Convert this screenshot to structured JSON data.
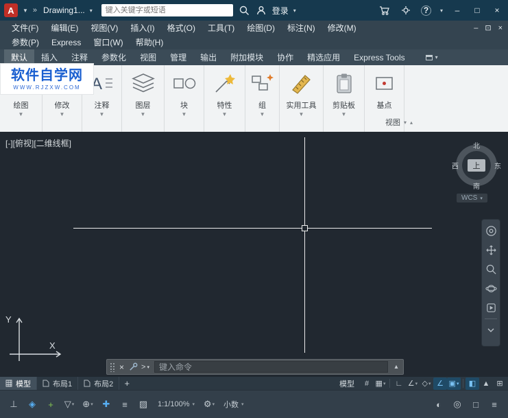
{
  "titlebar": {
    "doc_title": "Drawing1...",
    "search_placeholder": "键入关键字或短语",
    "signin": "登录",
    "help": "?"
  },
  "menubar": {
    "row1": [
      "文件(F)",
      "编辑(E)",
      "视图(V)",
      "插入(I)",
      "格式(O)",
      "工具(T)",
      "绘图(D)",
      "标注(N)",
      "修改(M)"
    ],
    "row2": [
      "参数(P)",
      "Express",
      "窗口(W)",
      "帮助(H)"
    ]
  },
  "ribbon": {
    "tabs": [
      "默认",
      "插入",
      "注释",
      "参数化",
      "视图",
      "管理",
      "输出",
      "附加模块",
      "协作",
      "精选应用",
      "Express Tools"
    ],
    "panels": [
      "绘图",
      "修改",
      "注释",
      "图层",
      "块",
      "特性",
      "组",
      "实用工具",
      "剪贴板",
      "基点"
    ],
    "view_panel": "视图"
  },
  "watermark": {
    "title": "软件自学网",
    "url": "WWW.RJZXW.COM"
  },
  "drawing": {
    "viewport_label": "[-][俯视][二维线框]",
    "viewcube": {
      "north": "北",
      "south": "南",
      "west": "西",
      "east": "东",
      "top": "上"
    },
    "wcs": "WCS"
  },
  "command": {
    "placeholder": "键入命令"
  },
  "layout": {
    "model": "模型",
    "layout1": "布局1",
    "layout2": "布局2",
    "add": "+"
  },
  "status": {
    "model": "模型",
    "scale": "1:1/100%",
    "units": "小数"
  },
  "icons": {
    "logo": "A",
    "chevron_down": "▾",
    "chevron_up": "▴",
    "double_chevron": "»",
    "triangle_down": "▼",
    "minimize": "–",
    "maximize": "□",
    "restore": "⊡",
    "close": "×",
    "grid": "#",
    "snap": "▦",
    "ortho": "∟",
    "polar": "∠",
    "isometric": "◇",
    "otrack": "∠",
    "osnap": "▣",
    "cycling": "◧",
    "annotation": "▲",
    "quickprops": "⊞",
    "dynucs": "⊥",
    "osnap3d": "◈",
    "dyninput": "+",
    "filter": "▽",
    "gizmo": "⊕",
    "monitor": "✚",
    "lineweight": "≡",
    "transparency": "▨",
    "gear": "⚙",
    "isolate": "◐",
    "hardware": "◎",
    "cleanscreen": "□",
    "menu": "≡",
    "history": "▴"
  }
}
